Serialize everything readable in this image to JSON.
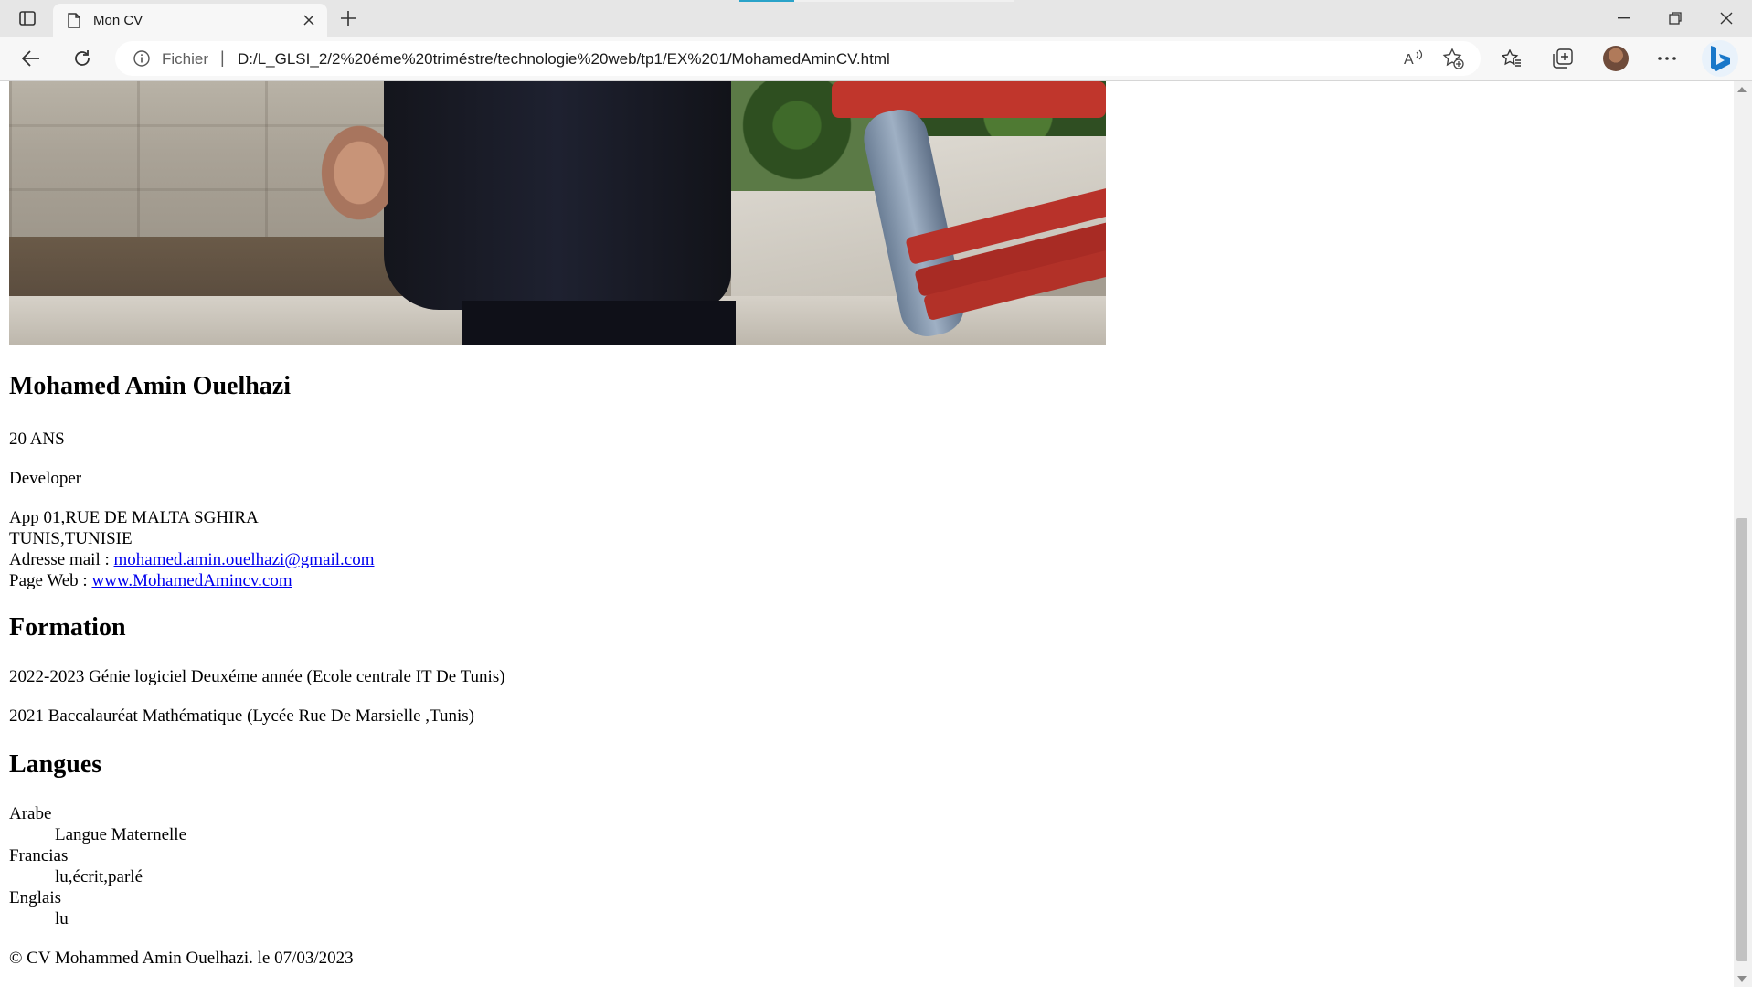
{
  "browser": {
    "tab_title": "Mon CV",
    "address": {
      "scheme_label": "Fichier",
      "separator": "|",
      "url": "D:/L_GLSI_2/2%20éme%20triméstre/technologie%20web/tp1/EX%201/MohamedAminCV.html"
    },
    "icons": {
      "tab_actions": "tab-actions-icon",
      "page": "page-icon",
      "close": "close-icon",
      "new_tab": "plus-icon",
      "minimize": "minimize-icon",
      "restore": "restore-icon",
      "window_close": "close-icon",
      "back": "back-arrow-icon",
      "reload": "reload-icon",
      "info": "info-icon",
      "read_aloud": "read-aloud-icon",
      "add_favorite": "add-favorite-icon",
      "favorites": "favorites-icon",
      "collections": "collections-icon",
      "profile": "profile-avatar",
      "menu": "more-icon",
      "copilot": "bing-icon"
    },
    "colors": {
      "tabbar_bg": "#e6e6e6",
      "toolbar_bg": "#f7f7f7",
      "link": "#0000ee",
      "bing_blue": "#1877c9"
    }
  },
  "cv": {
    "name": "Mohamed Amin Ouelhazi",
    "age": "20 ANS",
    "job": "Developer",
    "address_line1": "App 01,RUE DE MALTA SGHIRA",
    "address_line2": "TUNIS,TUNISIE",
    "email_label": "Adresse mail : ",
    "email": "mohamed.amin.ouelhazi@gmail.com",
    "web_label": "Page Web : ",
    "web": "www.MohamedAmincv.com",
    "formation_heading": "Formation",
    "formation": [
      "2022-2023 Génie logiciel Deuxéme année (Ecole centrale IT De Tunis)",
      "2021 Baccalauréat Mathématique (Lycée Rue De Marsielle ,Tunis)"
    ],
    "langues_heading": "Langues",
    "langues": [
      {
        "term": "Arabe",
        "desc": "Langue Maternelle"
      },
      {
        "term": "Francias",
        "desc": "lu,écrit,parlé"
      },
      {
        "term": "Englais",
        "desc": "lu"
      }
    ],
    "footer": "© CV Mohammed Amin Ouelhazi. le 07/03/2023"
  }
}
